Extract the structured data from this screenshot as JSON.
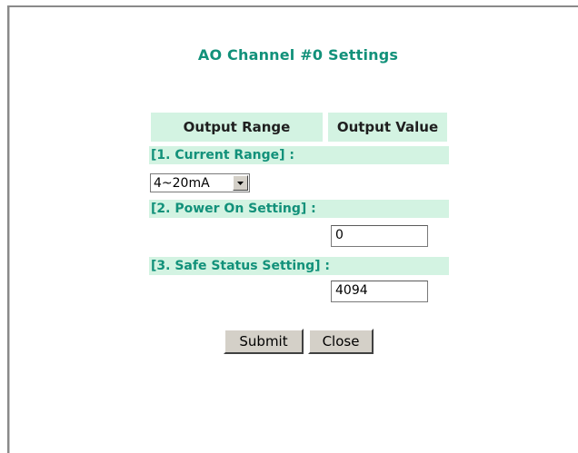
{
  "page": {
    "title": "AO Channel #0 Settings"
  },
  "table": {
    "headers": [
      "Output Range",
      "Output Value"
    ]
  },
  "sections": [
    {
      "label": "[1. Current Range] :"
    },
    {
      "label": "[2. Power On Setting] :"
    },
    {
      "label": "[3. Safe Status Setting] :"
    }
  ],
  "current_range": {
    "selected": "4~20mA"
  },
  "power_on": {
    "value": "0"
  },
  "safe_status": {
    "value": "4094"
  },
  "buttons": {
    "submit": "Submit",
    "close": "Close"
  },
  "colors": {
    "accent": "#12917a",
    "row_bg": "#d3f3e2",
    "button_face": "#d4d0c8"
  }
}
